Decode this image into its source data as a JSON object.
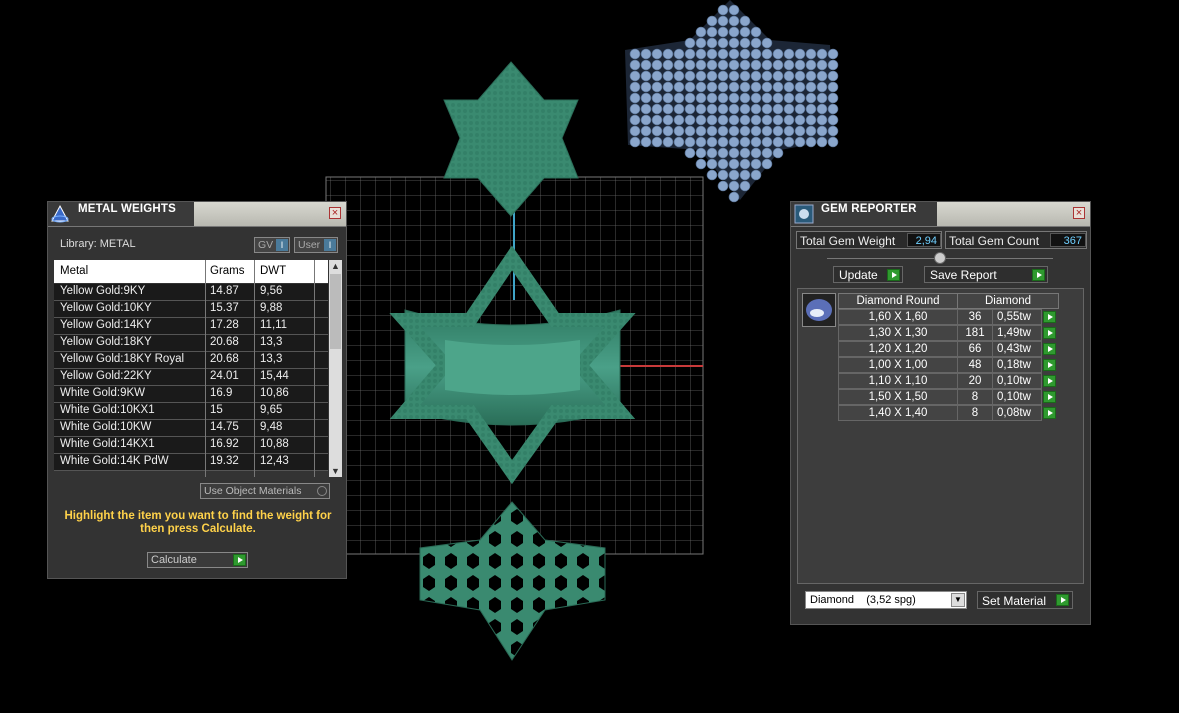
{
  "metal_panel": {
    "title": "METAL WEIGHTS",
    "library_label": "Library: METAL",
    "toggle_gv": "GV",
    "toggle_user": "User",
    "headers": [
      "Metal",
      "Grams",
      "DWT"
    ],
    "rows": [
      [
        "Yellow Gold:9KY",
        "14.87",
        "9,56"
      ],
      [
        "Yellow Gold:10KY",
        "15.37",
        "9,88"
      ],
      [
        "Yellow Gold:14KY",
        "17.28",
        "11,11"
      ],
      [
        "Yellow Gold:18KY",
        "20.68",
        "13,3"
      ],
      [
        "Yellow Gold:18KY Royal",
        "20.68",
        "13,3"
      ],
      [
        "Yellow Gold:22KY",
        "24.01",
        "15,44"
      ],
      [
        "White Gold:9KW",
        "16.9",
        "10,86"
      ],
      [
        "White Gold:10KX1",
        "15",
        "9,65"
      ],
      [
        "White Gold:10KW",
        "14.75",
        "9,48"
      ],
      [
        "White Gold:14KX1",
        "16.92",
        "10,88"
      ],
      [
        "White Gold:14K PdW",
        "19.32",
        "12,43"
      ]
    ],
    "use_object_materials": "Use Object Materials",
    "hint": "Highlight the item you want to find the weight for then press Calculate.",
    "calculate_label": "Calculate"
  },
  "gem_panel": {
    "title": "GEM REPORTER",
    "total_gem_weight_label": "Total Gem Weight",
    "total_gem_weight": "2,94",
    "total_gem_count_label": "Total Gem Count",
    "total_gem_count": "367",
    "update_label": "Update",
    "save_report_label": "Save Report",
    "table_header_shape": "Diamond Round",
    "table_header_material": "Diamond",
    "rows": [
      [
        "1,60 X 1,60",
        "36",
        "0,55tw"
      ],
      [
        "1,30 X 1,30",
        "181",
        "1,49tw"
      ],
      [
        "1,20 X 1,20",
        "66",
        "0,43tw"
      ],
      [
        "1,00 X 1,00",
        "48",
        "0,18tw"
      ],
      [
        "1,10 X 1,10",
        "20",
        "0,10tw"
      ],
      [
        "1,50 X 1,50",
        "8",
        "0,10tw"
      ],
      [
        "1,40 X 1,40",
        "8",
        "0,08tw"
      ]
    ],
    "material_select": "Diamond    (3,52 spg)",
    "set_material_label": "Set Material"
  },
  "colors": {
    "model_green": "#3a8a70",
    "gem_blue": "#8aa6cc",
    "hint_yellow": "#ffd24a",
    "value_cyan": "#6fd0ff",
    "go_green": "#2f9a2f"
  }
}
